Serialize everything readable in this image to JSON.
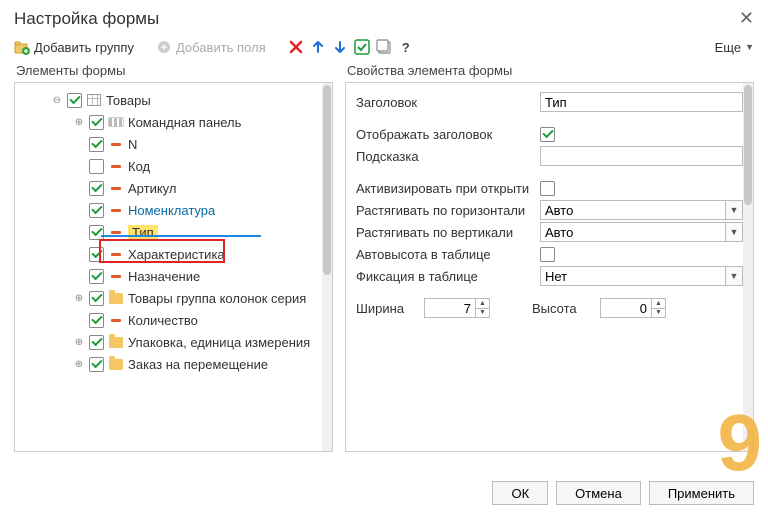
{
  "header": {
    "title": "Настройка формы"
  },
  "toolbar": {
    "add_group": "Добавить группу",
    "add_fields": "Добавить поля",
    "more": "Еще"
  },
  "left": {
    "title": "Элементы формы",
    "items": [
      {
        "label": "Товары",
        "checked": true,
        "type": "table",
        "expander": "−",
        "indent": 0
      },
      {
        "label": "Командная панель",
        "checked": true,
        "type": "cmd",
        "expander": "+",
        "indent": 1
      },
      {
        "label": "N",
        "checked": true,
        "type": "field",
        "expander": "",
        "indent": 1
      },
      {
        "label": "Код",
        "checked": false,
        "type": "field",
        "expander": "",
        "indent": 1
      },
      {
        "label": "Артикул",
        "checked": true,
        "type": "field",
        "expander": "",
        "indent": 1
      },
      {
        "label": "Номенклатура",
        "checked": true,
        "type": "field",
        "expander": "",
        "indent": 1,
        "row_class": "row-nomen"
      },
      {
        "label": "Тип",
        "checked": true,
        "type": "field",
        "expander": "",
        "indent": 1,
        "row_class": "row-tip"
      },
      {
        "label": "Характеристика",
        "checked": true,
        "type": "field",
        "expander": "",
        "indent": 1
      },
      {
        "label": "Назначение",
        "checked": true,
        "type": "field",
        "expander": "",
        "indent": 1
      },
      {
        "label": "Товары группа колонок серия",
        "checked": true,
        "type": "folder",
        "expander": "+",
        "indent": 1
      },
      {
        "label": "Количество",
        "checked": true,
        "type": "field",
        "expander": "",
        "indent": 1
      },
      {
        "label": "Упаковка, единица измерения",
        "checked": true,
        "type": "folder",
        "expander": "+",
        "indent": 1
      },
      {
        "label": "Заказ на перемещение",
        "checked": true,
        "type": "folder",
        "expander": "+",
        "indent": 1
      }
    ]
  },
  "right": {
    "title": "Свойства элемента формы",
    "header_label": "Заголовок",
    "header_value": "Тип",
    "show_header_label": "Отображать заголовок",
    "show_header_checked": true,
    "hint_label": "Подсказка",
    "hint_value": "",
    "activate_label": "Активизировать при открыти",
    "activate_checked": false,
    "stretch_h_label": "Растягивать по горизонтали",
    "stretch_h_value": "Авто",
    "stretch_v_label": "Растягивать по вертикали",
    "stretch_v_value": "Авто",
    "autoheight_label": "Автовысота в таблице",
    "autoheight_checked": false,
    "fixation_label": "Фиксация в таблице",
    "fixation_value": "Нет",
    "width_label": "Ширина",
    "width_value": "7",
    "height_label": "Высота",
    "height_value": "0"
  },
  "footer": {
    "ok": "ОК",
    "cancel": "Отмена",
    "apply": "Применить"
  },
  "watermark": "9"
}
